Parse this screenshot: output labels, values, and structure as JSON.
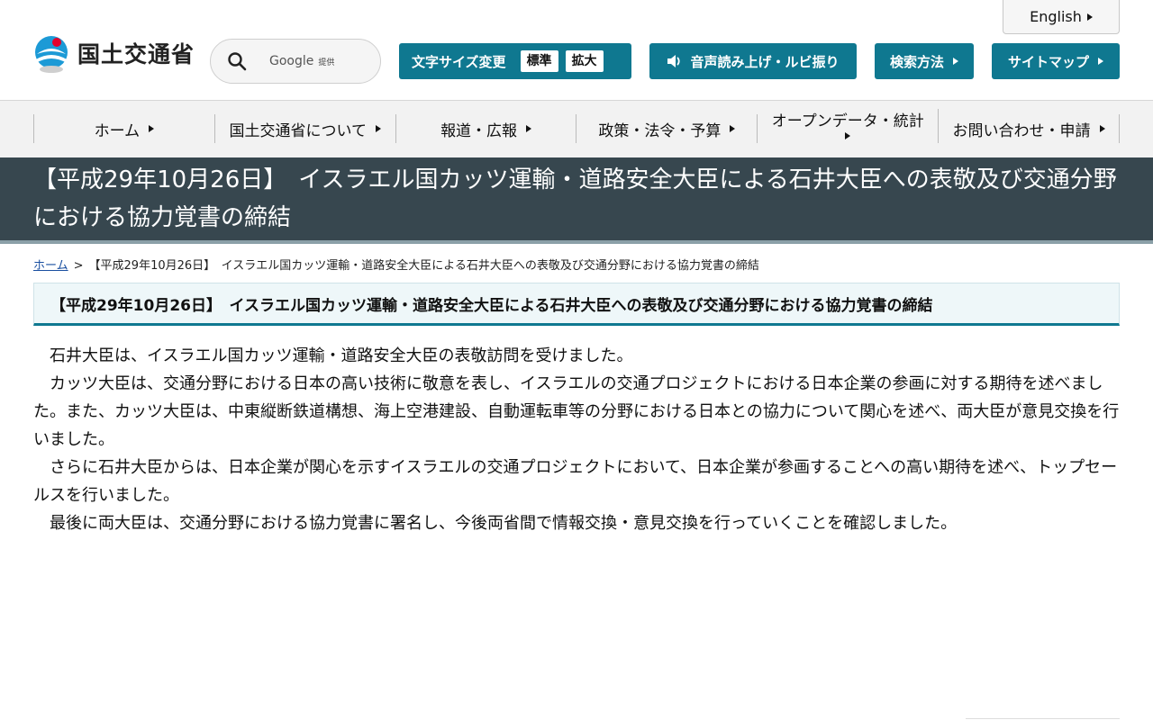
{
  "header": {
    "logo_text": "国土交通省",
    "language_label": "English",
    "search": {
      "brand": "Google",
      "brand_sub": "提供"
    },
    "font_size": {
      "label": "文字サイズ変更",
      "standard": "標準",
      "large": "拡大"
    },
    "voice_label": "音声読み上げ・ルビ振り",
    "search_method_label": "検索方法",
    "sitemap_label": "サイトマップ"
  },
  "nav": {
    "items": [
      {
        "label": "ホーム"
      },
      {
        "label": "国土交通省について"
      },
      {
        "label": "報道・広報"
      },
      {
        "label": "政策・法令・予算"
      },
      {
        "label": "オープンデータ・統計"
      },
      {
        "label": "お問い合わせ・申請"
      }
    ]
  },
  "page": {
    "title": "【平成29年10月26日】　イスラエル国カッツ運輸・道路安全大臣による石井大臣への表敬及び交通分野における協力覚書の締結",
    "breadcrumb": {
      "home": "ホーム",
      "separator": ">",
      "current": "【平成29年10月26日】　イスラエル国カッツ運輸・道路安全大臣による石井大臣への表敬及び交通分野における協力覚書の締結"
    },
    "heading": "【平成29年10月26日】　イスラエル国カッツ運輸・道路安全大臣による石井大臣への表敬及び交通分野における協力覚書の締結",
    "paragraphs": [
      "石井大臣は、イスラエル国カッツ運輸・道路安全大臣の表敬訪問を受けました。",
      "カッツ大臣は、交通分野における日本の高い技術に敬意を表し、イスラエルの交通プロジェクトにおける日本企業の参画に対する期待を述べました。また、カッツ大臣は、中東縦断鉄道構想、海上空港建設、自動運転車等の分野における日本との協力について関心を述べ、両大臣が意見交換を行いました。",
      "さらに石井大臣からは、日本企業が関心を示すイスラエルの交通プロジェクトにおいて、日本企業が参画することへの高い期待を述べ、トップセールスを行いました。",
      "最後に両大臣は、交通分野における協力覚書に署名し、今後両省間で情報交換・意見交換を行っていくことを確認しました。"
    ]
  },
  "colors": {
    "accent": "#0f7890",
    "title_band": "#37474f",
    "nav_bg": "#f2f2f2",
    "link": "#1a4fa0"
  }
}
